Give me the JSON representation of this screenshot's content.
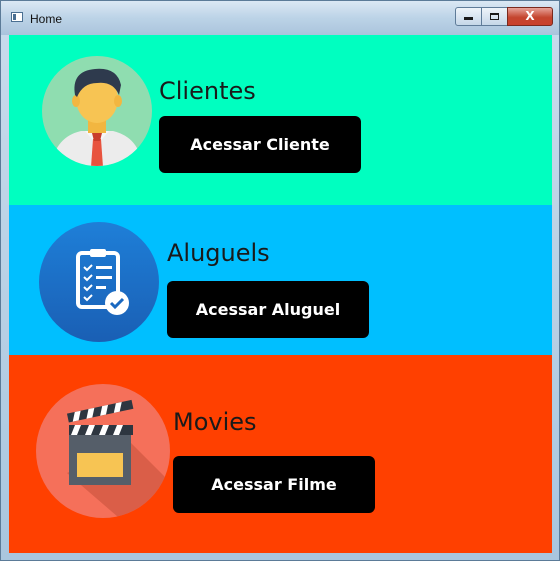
{
  "window": {
    "title": "Home",
    "controls": {
      "minimize": "minimize-icon",
      "maximize": "maximize-icon",
      "close": "X"
    }
  },
  "sections": [
    {
      "heading": "Clientes",
      "button_label": "Acessar Cliente",
      "icon": "businessman-avatar-icon",
      "color": "#00ffc0"
    },
    {
      "heading": "Aluguels",
      "button_label": "Acessar Aluguel",
      "icon": "clipboard-checklist-icon",
      "color": "#00bfff"
    },
    {
      "heading": "Movies",
      "button_label": "Acessar Filme",
      "icon": "clapperboard-icon",
      "color": "#ff4000"
    }
  ]
}
